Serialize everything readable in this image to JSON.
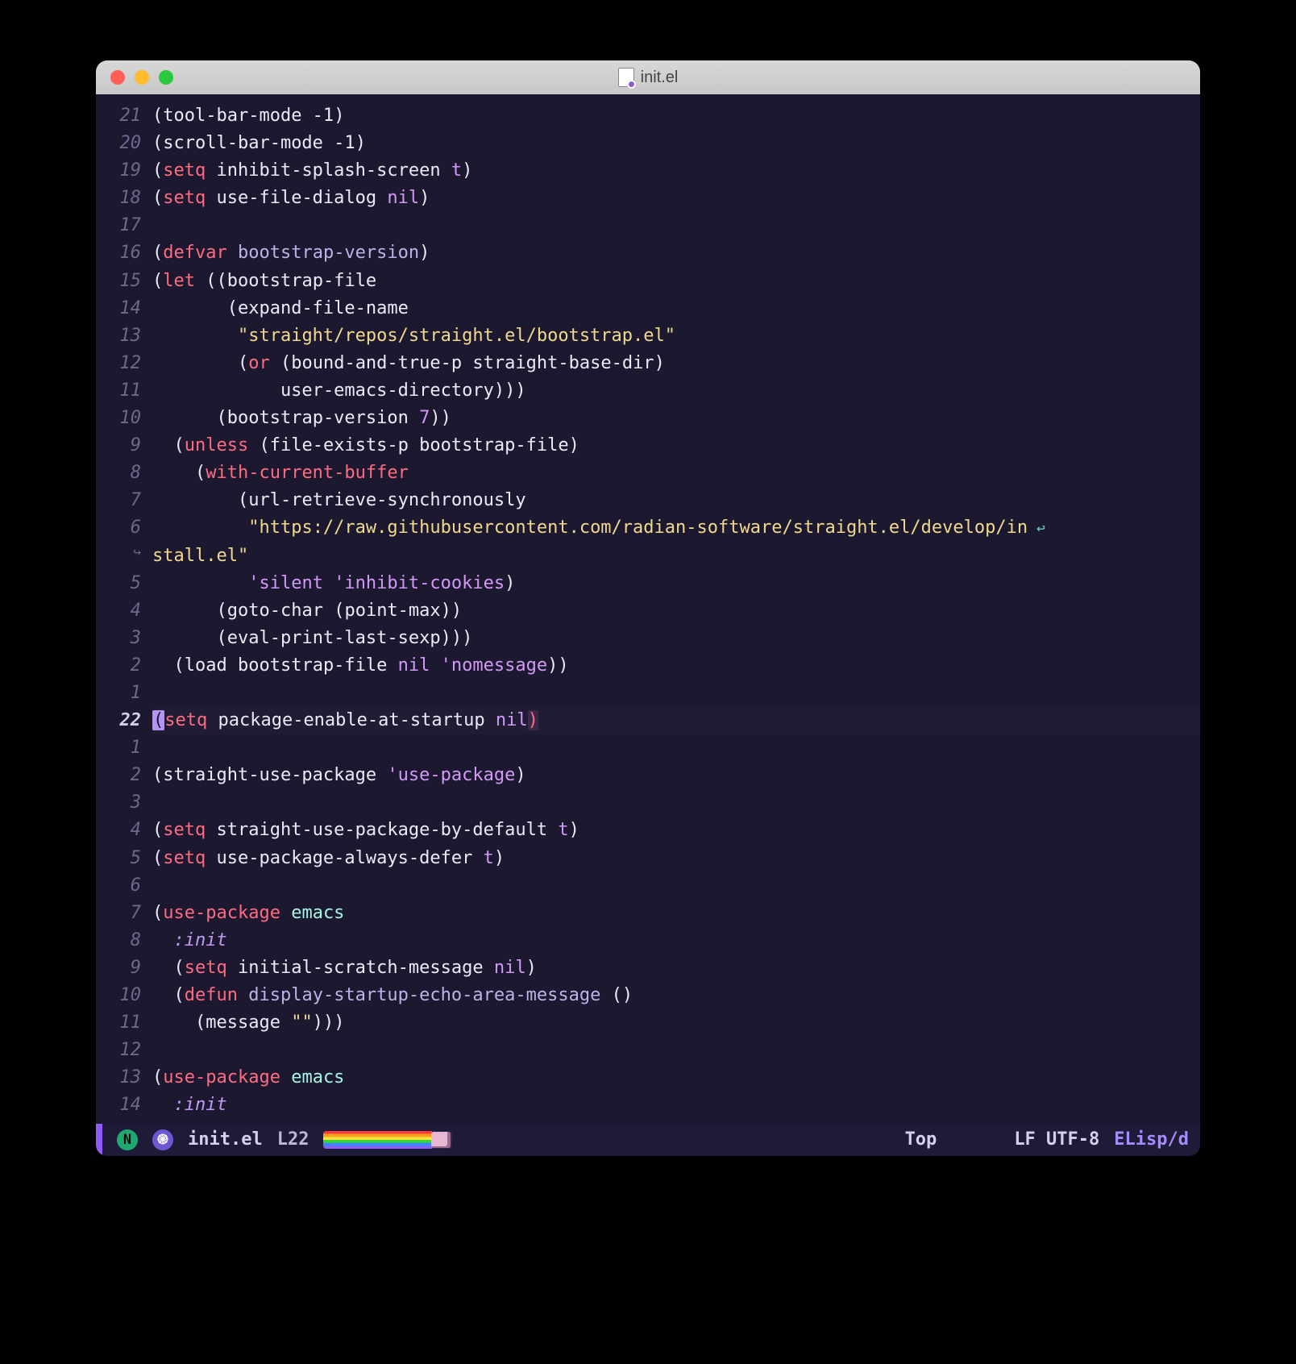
{
  "window": {
    "title": "init.el"
  },
  "modeline": {
    "badge": "N",
    "file": "init.el",
    "position": "L22",
    "scroll": "Top",
    "encoding": "LF UTF-8",
    "mode": "ELisp/d"
  },
  "code": {
    "lines": [
      {
        "n": "21",
        "tokens": [
          [
            "paren",
            "("
          ],
          [
            "fn",
            "tool-bar-mode"
          ],
          [
            "sym",
            " -1"
          ],
          [
            "paren",
            ")"
          ]
        ]
      },
      {
        "n": "20",
        "tokens": [
          [
            "paren",
            "("
          ],
          [
            "fn",
            "scroll-bar-mode"
          ],
          [
            "sym",
            " -1"
          ],
          [
            "paren",
            ")"
          ]
        ]
      },
      {
        "n": "19",
        "tokens": [
          [
            "paren",
            "("
          ],
          [
            "kw",
            "setq"
          ],
          [
            "sym",
            " inhibit-splash-screen "
          ],
          [
            "const",
            "t"
          ],
          [
            "paren",
            ")"
          ]
        ]
      },
      {
        "n": "18",
        "tokens": [
          [
            "paren",
            "("
          ],
          [
            "kw",
            "setq"
          ],
          [
            "sym",
            " use-file-dialog "
          ],
          [
            "const",
            "nil"
          ],
          [
            "paren",
            ")"
          ]
        ]
      },
      {
        "n": "17",
        "tokens": []
      },
      {
        "n": "16",
        "tokens": [
          [
            "paren",
            "("
          ],
          [
            "def",
            "defvar"
          ],
          [
            "sym",
            " "
          ],
          [
            "name",
            "bootstrap-version"
          ],
          [
            "paren",
            ")"
          ]
        ]
      },
      {
        "n": "15",
        "tokens": [
          [
            "paren",
            "("
          ],
          [
            "kw",
            "let"
          ],
          [
            "sym",
            " "
          ],
          [
            "paren",
            "(("
          ],
          [
            "sym",
            "bootstrap-file"
          ]
        ]
      },
      {
        "n": "14",
        "tokens": [
          [
            "sym",
            "       "
          ],
          [
            "paren",
            "("
          ],
          [
            "fn",
            "expand-file-name"
          ]
        ]
      },
      {
        "n": "13",
        "tokens": [
          [
            "sym",
            "        "
          ],
          [
            "str",
            "\"straight/repos/straight.el/bootstrap.el\""
          ]
        ]
      },
      {
        "n": "12",
        "tokens": [
          [
            "sym",
            "        "
          ],
          [
            "paren",
            "("
          ],
          [
            "kw",
            "or"
          ],
          [
            "sym",
            " "
          ],
          [
            "paren",
            "("
          ],
          [
            "fn",
            "bound-and-true-p"
          ],
          [
            "sym",
            " straight-base-dir"
          ],
          [
            "paren",
            ")"
          ]
        ]
      },
      {
        "n": "11",
        "tokens": [
          [
            "sym",
            "            user-emacs-directory"
          ],
          [
            "paren",
            ")))"
          ]
        ]
      },
      {
        "n": "10",
        "tokens": [
          [
            "sym",
            "      "
          ],
          [
            "paren",
            "("
          ],
          [
            "sym",
            "bootstrap-version "
          ],
          [
            "num",
            "7"
          ],
          [
            "paren",
            "))"
          ]
        ]
      },
      {
        "n": "9",
        "tokens": [
          [
            "sym",
            "  "
          ],
          [
            "paren",
            "("
          ],
          [
            "kw",
            "unless"
          ],
          [
            "sym",
            " "
          ],
          [
            "paren",
            "("
          ],
          [
            "fn",
            "file-exists-p"
          ],
          [
            "sym",
            " bootstrap-file"
          ],
          [
            "paren",
            ")"
          ]
        ]
      },
      {
        "n": "8",
        "tokens": [
          [
            "sym",
            "    "
          ],
          [
            "paren",
            "("
          ],
          [
            "kw",
            "with-current-buffer"
          ]
        ]
      },
      {
        "n": "7",
        "tokens": [
          [
            "sym",
            "        "
          ],
          [
            "paren",
            "("
          ],
          [
            "fn",
            "url-retrieve-synchronously"
          ]
        ]
      },
      {
        "n": "6",
        "tokens": [
          [
            "sym",
            "         "
          ],
          [
            "str",
            "\"https://raw.githubusercontent.com/radian-software/straight.el/develop/in"
          ]
        ],
        "wrapRight": true
      },
      {
        "n": "",
        "wrapLeft": true,
        "tokens": [
          [
            "str",
            "stall.el\""
          ]
        ]
      },
      {
        "n": "5",
        "tokens": [
          [
            "sym",
            "         "
          ],
          [
            "quote",
            "'silent"
          ],
          [
            "sym",
            " "
          ],
          [
            "quote",
            "'inhibit-cookies"
          ],
          [
            "paren",
            ")"
          ]
        ]
      },
      {
        "n": "4",
        "tokens": [
          [
            "sym",
            "      "
          ],
          [
            "paren",
            "("
          ],
          [
            "fn",
            "goto-char"
          ],
          [
            "sym",
            " "
          ],
          [
            "paren",
            "("
          ],
          [
            "fn",
            "point-max"
          ],
          [
            "paren",
            "))"
          ]
        ]
      },
      {
        "n": "3",
        "tokens": [
          [
            "sym",
            "      "
          ],
          [
            "paren",
            "("
          ],
          [
            "fn",
            "eval-print-last-sexp"
          ],
          [
            "paren",
            ")))"
          ]
        ]
      },
      {
        "n": "2",
        "tokens": [
          [
            "sym",
            "  "
          ],
          [
            "paren",
            "("
          ],
          [
            "fn",
            "load"
          ],
          [
            "sym",
            " bootstrap-file "
          ],
          [
            "const",
            "nil"
          ],
          [
            "sym",
            " "
          ],
          [
            "quote",
            "'nomessage"
          ],
          [
            "paren",
            "))"
          ]
        ]
      },
      {
        "n": "1",
        "tokens": []
      },
      {
        "n": "22",
        "current": true,
        "tokens": [
          [
            "hl-paren",
            "("
          ],
          [
            "kw",
            "setq"
          ],
          [
            "sym",
            " package-enable-at-startup "
          ],
          [
            "const",
            "nil"
          ],
          [
            "hl-paren-close",
            ")"
          ]
        ]
      },
      {
        "n": "1",
        "tokens": []
      },
      {
        "n": "2",
        "tokens": [
          [
            "paren",
            "("
          ],
          [
            "fn",
            "straight-use-package"
          ],
          [
            "sym",
            " "
          ],
          [
            "quote",
            "'use-package"
          ],
          [
            "paren",
            ")"
          ]
        ]
      },
      {
        "n": "3",
        "tokens": []
      },
      {
        "n": "4",
        "tokens": [
          [
            "paren",
            "("
          ],
          [
            "kw",
            "setq"
          ],
          [
            "sym",
            " straight-use-package-by-default "
          ],
          [
            "const",
            "t"
          ],
          [
            "paren",
            ")"
          ]
        ]
      },
      {
        "n": "5",
        "tokens": [
          [
            "paren",
            "("
          ],
          [
            "kw",
            "setq"
          ],
          [
            "sym",
            " use-package-always-defer "
          ],
          [
            "const",
            "t"
          ],
          [
            "paren",
            ")"
          ]
        ]
      },
      {
        "n": "6",
        "tokens": []
      },
      {
        "n": "7",
        "tokens": [
          [
            "paren",
            "("
          ],
          [
            "def",
            "use-package"
          ],
          [
            "sym",
            " "
          ],
          [
            "emacs",
            "emacs"
          ]
        ]
      },
      {
        "n": "8",
        "tokens": [
          [
            "sym",
            "  "
          ],
          [
            "key",
            ":init"
          ]
        ]
      },
      {
        "n": "9",
        "tokens": [
          [
            "sym",
            "  "
          ],
          [
            "paren",
            "("
          ],
          [
            "kw",
            "setq"
          ],
          [
            "sym",
            " initial-scratch-message "
          ],
          [
            "const",
            "nil"
          ],
          [
            "paren",
            ")"
          ]
        ]
      },
      {
        "n": "10",
        "tokens": [
          [
            "sym",
            "  "
          ],
          [
            "paren",
            "("
          ],
          [
            "def",
            "defun"
          ],
          [
            "sym",
            " "
          ],
          [
            "name",
            "display-startup-echo-area-message"
          ],
          [
            "sym",
            " "
          ],
          [
            "paren",
            "()"
          ]
        ]
      },
      {
        "n": "11",
        "tokens": [
          [
            "sym",
            "    "
          ],
          [
            "paren",
            "("
          ],
          [
            "fn",
            "message"
          ],
          [
            "sym",
            " "
          ],
          [
            "str",
            "\"\""
          ],
          [
            "paren",
            ")))"
          ]
        ]
      },
      {
        "n": "12",
        "tokens": []
      },
      {
        "n": "13",
        "tokens": [
          [
            "paren",
            "("
          ],
          [
            "def",
            "use-package"
          ],
          [
            "sym",
            " "
          ],
          [
            "emacs",
            "emacs"
          ]
        ]
      },
      {
        "n": "14",
        "tokens": [
          [
            "sym",
            "  "
          ],
          [
            "key",
            ":init"
          ]
        ]
      }
    ]
  }
}
